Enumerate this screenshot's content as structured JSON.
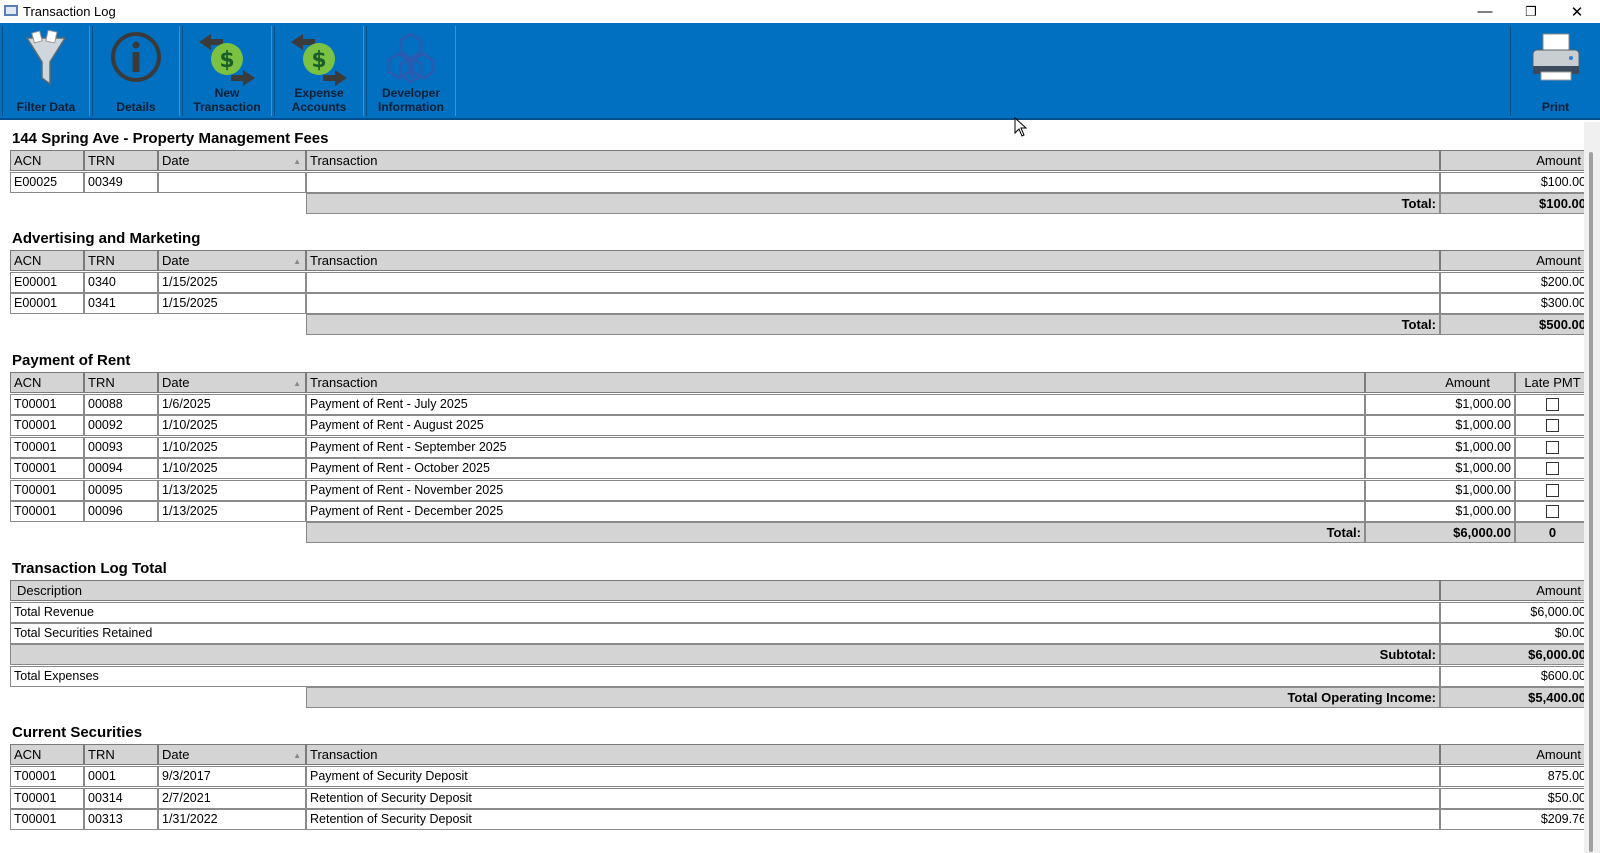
{
  "window": {
    "title": "Transaction Log",
    "minimize": "—",
    "restore": "❐",
    "close": "✕"
  },
  "toolbar": {
    "filter_label": "Filter Data",
    "details_label": "Details",
    "new_transaction_label": "New\nTransaction",
    "expense_accounts_label": "Expense\nAccounts",
    "developer_label": "Developer\nInformation",
    "print_label": "Print"
  },
  "columns": {
    "acn": "ACN",
    "trn": "TRN",
    "date": "Date",
    "transaction": "Transaction",
    "amount": "Amount",
    "late": "Late PMT",
    "description": "Description"
  },
  "property_fees": {
    "title": "144 Spring Ave - Property Management Fees",
    "rows": [
      {
        "acn": "E00025",
        "trn": "00349",
        "date": "",
        "transaction": "",
        "amount": "$100.00"
      }
    ],
    "total_label": "Total:",
    "total": "$100.00"
  },
  "advertising": {
    "title": "Advertising and Marketing",
    "rows": [
      {
        "acn": "E00001",
        "trn": "0340",
        "date": "1/15/2025",
        "transaction": "",
        "amount": "$200.00"
      },
      {
        "acn": "E00001",
        "trn": "0341",
        "date": "1/15/2025",
        "transaction": "",
        "amount": "$300.00"
      }
    ],
    "total_label": "Total:",
    "total": "$500.00"
  },
  "rent": {
    "title": "Payment of Rent",
    "rows": [
      {
        "acn": "T00001",
        "trn": "00088",
        "date": "1/6/2025",
        "transaction": "Payment of Rent - July 2025",
        "amount": "$1,000.00",
        "late": false
      },
      {
        "acn": "T00001",
        "trn": "00092",
        "date": "1/10/2025",
        "transaction": "Payment of Rent - August 2025",
        "amount": "$1,000.00",
        "late": false
      },
      {
        "acn": "T00001",
        "trn": "00093",
        "date": "1/10/2025",
        "transaction": "Payment of Rent - September 2025",
        "amount": "$1,000.00",
        "late": false
      },
      {
        "acn": "T00001",
        "trn": "00094",
        "date": "1/10/2025",
        "transaction": "Payment of Rent - October 2025",
        "amount": "$1,000.00",
        "late": false
      },
      {
        "acn": "T00001",
        "trn": "00095",
        "date": "1/13/2025",
        "transaction": "Payment of Rent - November 2025",
        "amount": "$1,000.00",
        "late": false
      },
      {
        "acn": "T00001",
        "trn": "00096",
        "date": "1/13/2025",
        "transaction": "Payment of Rent - December 2025",
        "amount": "$1,000.00",
        "late": false
      }
    ],
    "total_label": "Total:",
    "total": "$6,000.00",
    "late_total": "0"
  },
  "log_total": {
    "title": "Transaction Log Total",
    "total_revenue_label": "Total Revenue",
    "total_revenue": "$6,000.00",
    "securities_retained_label": "Total Securities Retained",
    "securities_retained": "$0.00",
    "subtotal_label": "Subtotal:",
    "subtotal": "$6,000.00",
    "total_expenses_label": "Total Expenses",
    "total_expenses": "$600.00",
    "operating_income_label": "Total Operating Income:",
    "operating_income": "$5,400.00"
  },
  "securities": {
    "title": "Current Securities",
    "rows": [
      {
        "acn": "T00001",
        "trn": "0001",
        "date": "9/3/2017",
        "transaction": "Payment of Security Deposit",
        "amount": "875.00"
      },
      {
        "acn": "T00001",
        "trn": "00314",
        "date": "2/7/2021",
        "transaction": "Retention of Security Deposit",
        "amount": "$50.00"
      },
      {
        "acn": "T00001",
        "trn": "00313",
        "date": "1/31/2022",
        "transaction": "Retention of Security Deposit",
        "amount": "$209.76"
      }
    ]
  }
}
